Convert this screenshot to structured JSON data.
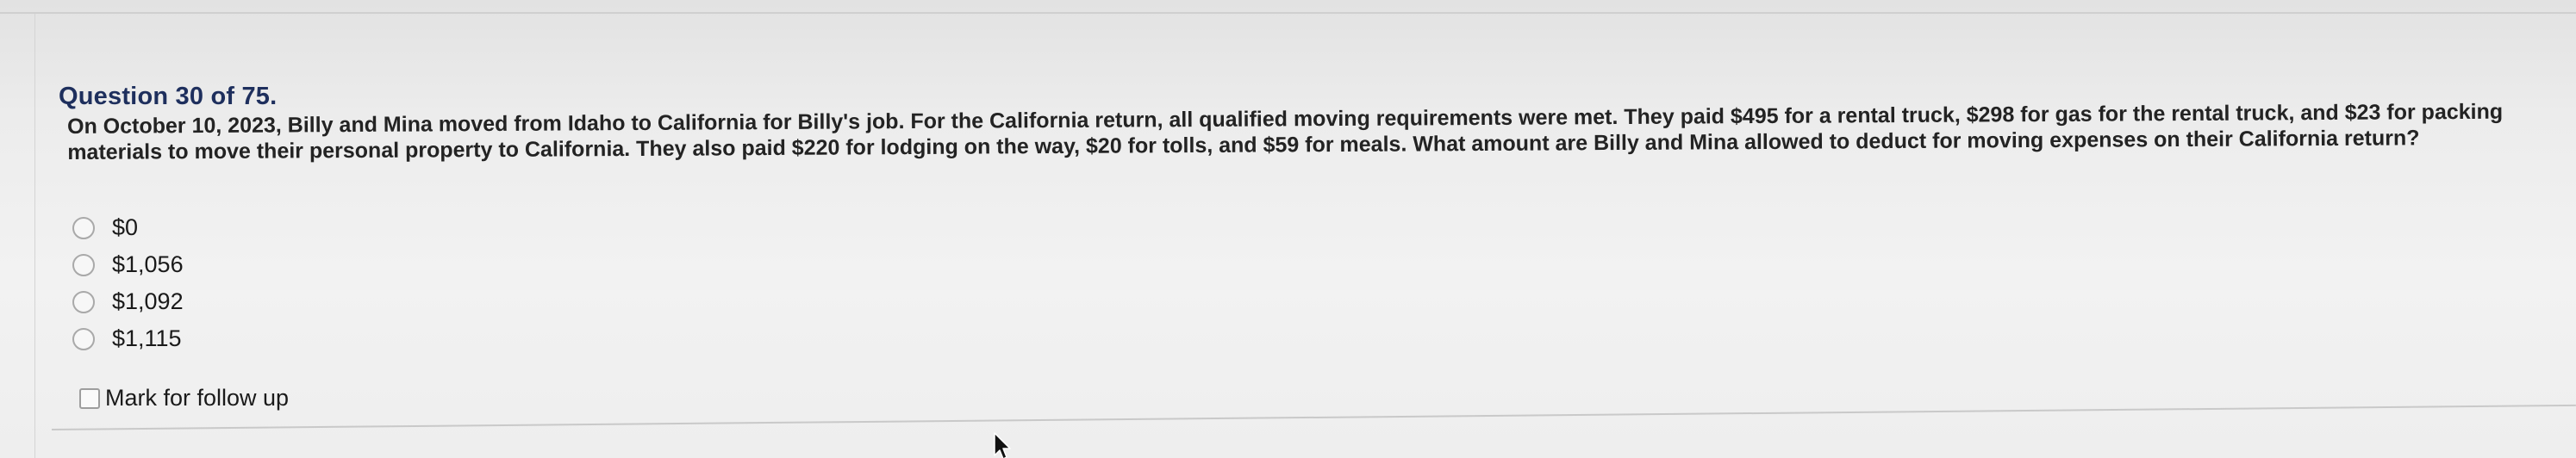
{
  "question": {
    "title": "Question 30 of 75.",
    "text": "On October 10, 2023, Billy and Mina moved from Idaho to California for Billy's job. For the California return, all qualified moving requirements were met. They paid $495 for a rental truck, $298 for gas for the rental truck, and $23 for packing materials to move their personal property to California. They also paid $220 for lodging on the way, $20 for tolls, and $59 for meals. What amount are Billy and Mina allowed to deduct for moving expenses on their California return?",
    "options": [
      {
        "label": "$0"
      },
      {
        "label": "$1,056"
      },
      {
        "label": "$1,092"
      },
      {
        "label": "$1,115"
      }
    ]
  },
  "follow_up": {
    "label": "Mark for follow up"
  },
  "icons": {
    "pointer": "mouse-pointer-icon"
  }
}
